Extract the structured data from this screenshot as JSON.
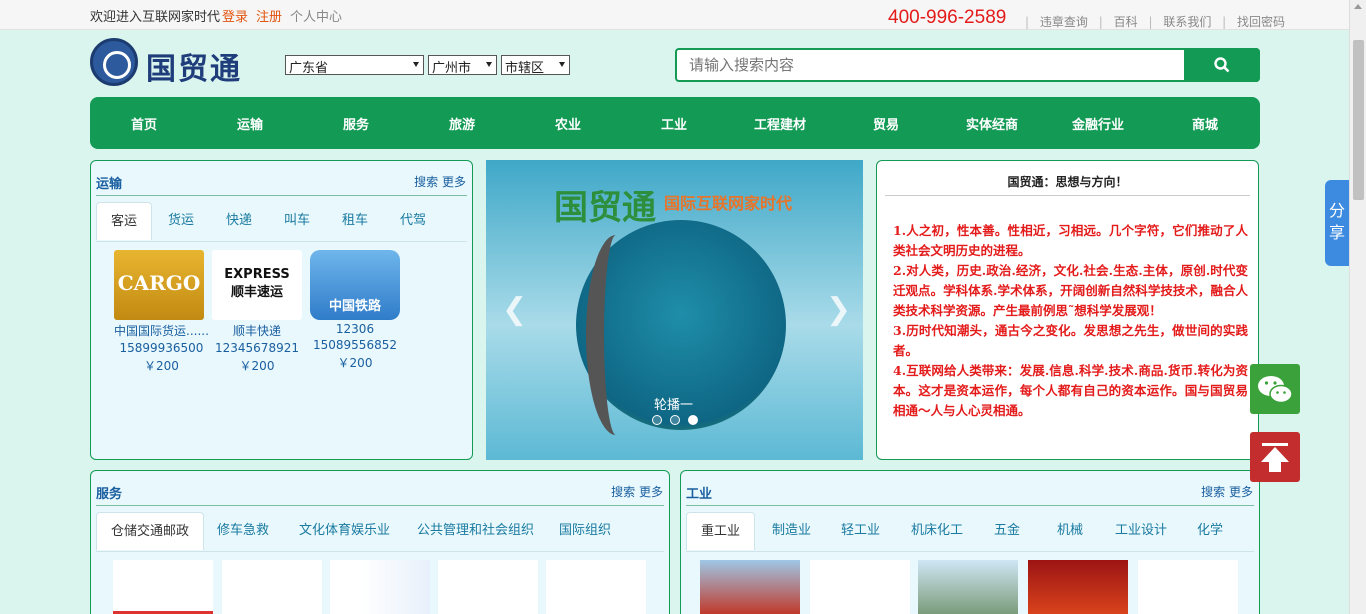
{
  "topbar": {
    "welcome": "欢迎进入互联网家时代",
    "login": "登录",
    "register": "注册",
    "user_center": "个人中心",
    "phone": "400-996-2589",
    "links": [
      "违章查询",
      "百科",
      "联系我们",
      "找回密码"
    ]
  },
  "logo": {
    "text": "国贸通"
  },
  "location": {
    "province": "广东省",
    "city": "广州市",
    "district": "市辖区"
  },
  "search": {
    "placeholder": "请输入搜索内容"
  },
  "nav": [
    "首页",
    "运输",
    "服务",
    "旅游",
    "农业",
    "工业",
    "工程建材",
    "贸易",
    "实体经商",
    "金融行业",
    "商城"
  ],
  "transport": {
    "title": "运输",
    "more": "搜索 更多",
    "tabs": [
      "客运",
      "货运",
      "快递",
      "叫车",
      "租车",
      "代驾"
    ],
    "cards": [
      {
        "name": "中国国际货运......",
        "phone": "15899936500",
        "price": "￥200"
      },
      {
        "name": "顺丰快递",
        "phone": "12345678921",
        "price": "￥200"
      },
      {
        "name": "12306",
        "phone": "15089556852",
        "price": "￥200"
      }
    ],
    "card_logos": [
      "CARGO",
      "EXPRESS\n顺丰速运",
      "中国铁路"
    ]
  },
  "banner": {
    "title": "国贸通",
    "subtitle": "国际互联网家时代",
    "caption": "轮播一",
    "slides": 3,
    "active_slide": 3
  },
  "thought": {
    "title": "国贸通：思想与方向！",
    "items": [
      "1.人之初，性本善。性相近，习相远。几个字符，它们推动了人类社会文明历史的进程。",
      "2.对人类，历史.政治.经济，文化.社会.生态.主体，原创.时代变迁观点。学科体系.学术体系，开阔创新自然科学技技术，融合人类技术科学资源。产生最前例思˜想科学发展观！",
      "3.历时代知潮头，通古今之变化。发思想之先生，做世间的实践者。",
      "4.互联网给人类带来：发展.信息.科学.技术.商品.货币.转化为资本。这才是资本运作，每个人都有自己的资本运作。国与国贸易相通～人与人心灵相通。"
    ]
  },
  "services": {
    "title": "服务",
    "more": "搜索 更多",
    "tabs": [
      "仓储交通邮政",
      "修车急救",
      "文化体育娱乐业",
      "公共管理和社会组织",
      "国际组织"
    ]
  },
  "industry": {
    "title": "工业",
    "more": "搜索 更多",
    "tabs": [
      "重工业",
      "制造业",
      "轻工业",
      "机床化工",
      "五金",
      "机械",
      "工业设计",
      "化学"
    ]
  },
  "floating": {
    "share": "分享"
  },
  "colors": {
    "brand_green": "#139a54",
    "accent_red": "#e41b1b",
    "link_blue": "#1a5fa0"
  }
}
